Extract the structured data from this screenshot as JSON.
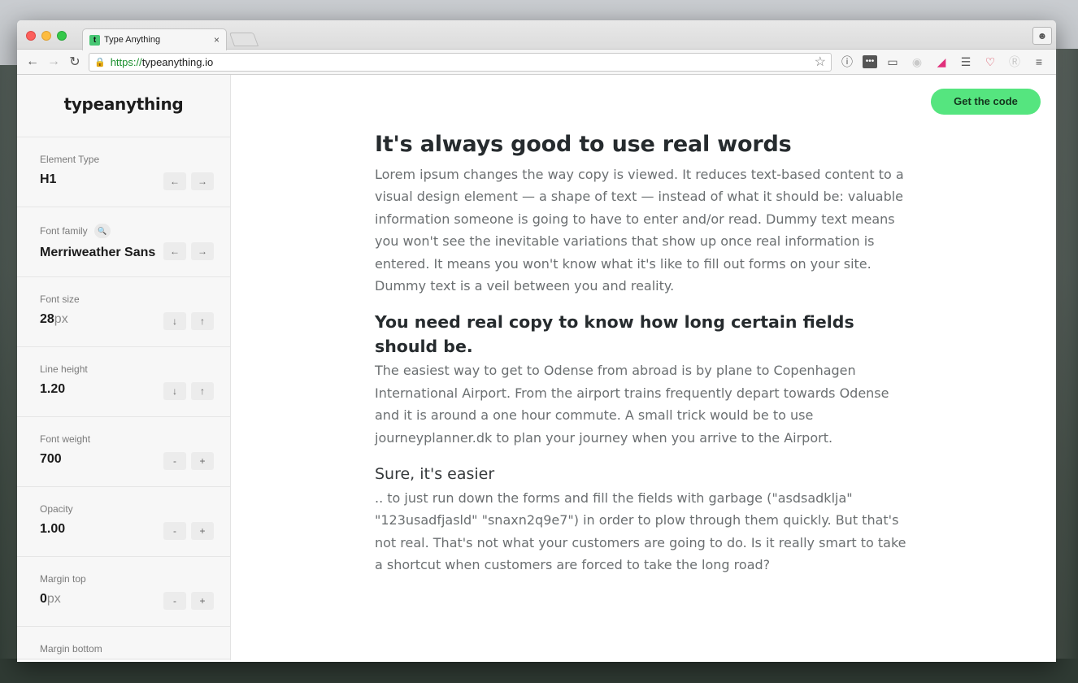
{
  "browser": {
    "tab_title": "Type Anything",
    "tab_favicon": "t",
    "tab_close": "×",
    "url_scheme": "https://",
    "url_host": "typeanything.io",
    "icons": {
      "back": "back-arrow-icon",
      "forward": "forward-arrow-icon",
      "reload": "reload-icon",
      "lock": "lock-icon",
      "star": "bookmark-star-icon",
      "menu": "hamburger-menu-icon"
    }
  },
  "sidebar": {
    "logo": "typeanything",
    "controls": [
      {
        "label": "Element Type",
        "value": "H1",
        "unit": "",
        "dec": "←",
        "inc": "→"
      },
      {
        "label": "Font family",
        "value": "Merriweather Sans",
        "unit": "",
        "dec": "←",
        "inc": "→"
      },
      {
        "label": "Font size",
        "value": "28",
        "unit": "px",
        "dec": "↓",
        "inc": "↑"
      },
      {
        "label": "Line height",
        "value": "1.20",
        "unit": "",
        "dec": "↓",
        "inc": "↑"
      },
      {
        "label": "Font weight",
        "value": "700",
        "unit": "",
        "dec": "-",
        "inc": "+"
      },
      {
        "label": "Opacity",
        "value": "1.00",
        "unit": "",
        "dec": "-",
        "inc": "+"
      },
      {
        "label": "Margin top",
        "value": "0",
        "unit": "px",
        "dec": "-",
        "inc": "+"
      },
      {
        "label": "Margin bottom",
        "value": "",
        "unit": "",
        "dec": "",
        "inc": ""
      }
    ]
  },
  "main": {
    "get_code": "Get the code",
    "h1": "It's always good to use real words",
    "p1": "Lorem ipsum changes the way copy is viewed. It reduces text-based content to a visual design element — a shape of text — instead of what it should be: valuable information someone is going to have to enter and/or read. Dummy text means you won't see the inevitable variations that show up once real information is entered. It means you won't know what it's like to fill out forms on your site. Dummy text is a veil between you and reality.",
    "h2": "You need real copy to know how long certain fields should be.",
    "p2": "The easiest way to get to Odense from abroad is by plane to Copenhagen International Airport. From the airport trains frequently depart towards Odense and it is around a one hour commute. A small trick would be to use journeyplanner.dk to plan your journey when you arrive to the Airport.",
    "h3": "Sure, it's easier",
    "p3": ".. to just run down the forms and fill the fields with garbage (\"asdsadklja\" \"123usadfjasld\" \"snaxn2q9e7\") in order to plow through them quickly. But that's not real. That's not what your customers are going to do. Is it really smart to take a shortcut when customers are forced to take the long road?"
  }
}
